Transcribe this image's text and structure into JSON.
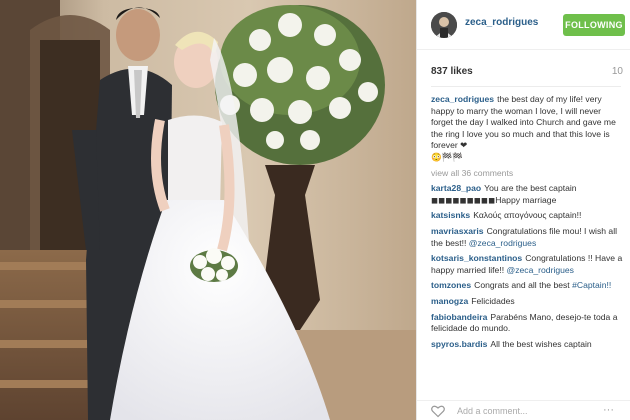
{
  "profile": {
    "username": "zeca_rodrigues",
    "follow_label": "FOLLOWING"
  },
  "post": {
    "likes": "837 likes",
    "time_ago": "10",
    "caption_user": "zeca_rodrigues",
    "caption_text": "the best day of my life! very happy to marry the woman I love, I will never forget the day I walked into Church and gave me the ring I love you so much and that this love is forever ❤",
    "caption_emoji": "😳🏁🏁"
  },
  "comments": {
    "view_all": "view all 36 comments",
    "list": [
      {
        "user": "karta28_pao",
        "text": "You are the best captain ◼◼◼◼◼◼◼◼◼Happy marriage"
      },
      {
        "user": "katsisnks",
        "text": "Καλούς απογόνους captain!!"
      },
      {
        "user": "mavriasxaris",
        "text": "Congratulations file mou! I wish all the best!! @zeca_rodrigues"
      },
      {
        "user": "kotsaris_konstantinos",
        "text": "Congratulations !! Have a happy married life!! @zeca_rodrigues"
      },
      {
        "user": "tomzones",
        "text": "Congrats and all the best #Captain!!"
      },
      {
        "user": "manogza",
        "text": "Felicidades"
      },
      {
        "user": "fabiobandeira",
        "text": "Parabéns Mano, desejo-te toda a felicidade do mundo."
      },
      {
        "user": "spyros.bardis",
        "text": "All the best wishes captain"
      }
    ]
  },
  "footer": {
    "add_comment_placeholder": "Add a comment...",
    "more_label": "···"
  },
  "icons": {
    "like": "heart-icon",
    "more": "more-options-icon"
  }
}
